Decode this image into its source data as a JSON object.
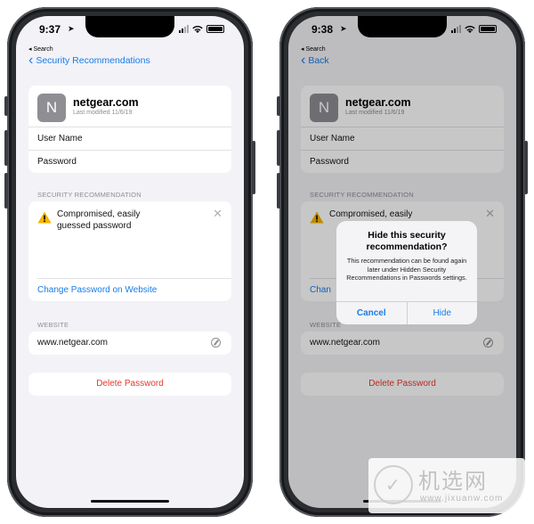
{
  "left_screen": {
    "status": {
      "time": "9:37",
      "back_app": "◂ Search"
    },
    "nav": {
      "back_label": "Security Recommendations"
    },
    "entry": {
      "avatar_letter": "N",
      "site": "netgear.com",
      "modified": "Last modified 11/6/19"
    },
    "fields": {
      "username_label": "User Name",
      "password_label": "Password"
    },
    "recommendation": {
      "section_header": "SECURITY RECOMMENDATION",
      "text_line1": "Compromised, easily",
      "text_line2": "guessed password",
      "action": "Change Password on Website"
    },
    "website": {
      "section_header": "WEBSITE",
      "url": "www.netgear.com"
    },
    "delete_label": "Delete Password"
  },
  "right_screen": {
    "status": {
      "time": "9:38",
      "back_app": "◂ Search"
    },
    "nav": {
      "back_label": "Back"
    },
    "entry": {
      "avatar_letter": "N",
      "site": "netgear.com",
      "modified": "Last modified 11/6/19"
    },
    "fields": {
      "username_label": "User Name",
      "password_label": "Password"
    },
    "recommendation": {
      "section_header": "SECURITY RECOMMENDATION",
      "text_line1": "Compromised, easily",
      "action_partial": "Chan"
    },
    "website": {
      "section_header": "WEBSITE",
      "url": "www.netgear.com"
    },
    "delete_label": "Delete Password",
    "alert": {
      "title_line1": "Hide this security",
      "title_line2": "recommendation?",
      "message": "This recommendation can be found again later under Hidden Security Recommendations in Passwords settings.",
      "cancel_label": "Cancel",
      "hide_label": "Hide"
    }
  },
  "watermark": {
    "title": "机选网",
    "url": "www.jixuanw.com"
  },
  "colors": {
    "accent": "#1a7ce8",
    "destructive": "#e5392d",
    "warning": "#f5b400",
    "background": "#f2f2f7"
  }
}
